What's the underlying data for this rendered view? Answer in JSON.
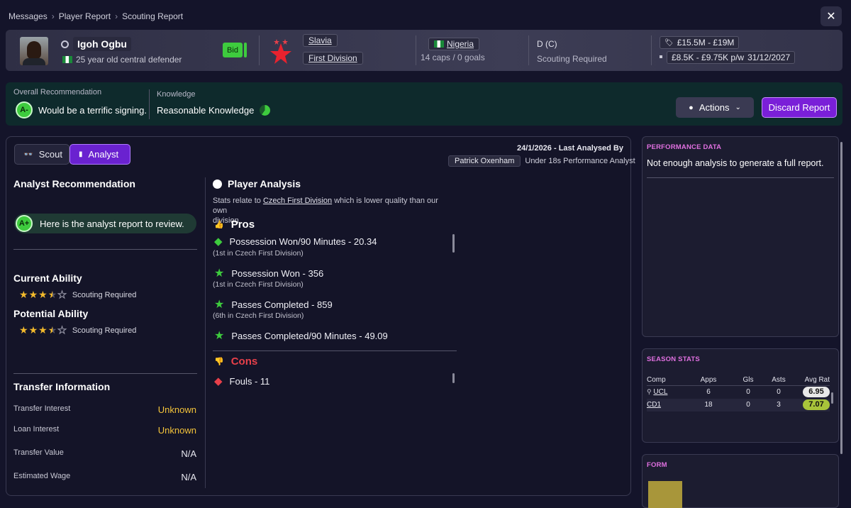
{
  "breadcrumb": [
    "Messages",
    "Player Report",
    "Scouting Report"
  ],
  "player": {
    "name": "Igoh Ogbu",
    "description": "25 year old central defender",
    "bid_label": "Bid"
  },
  "club": {
    "name": "Slavia",
    "league": "First Division"
  },
  "nation": {
    "name": "Nigeria",
    "caps": "14 caps / 0 goals"
  },
  "position": {
    "label": "D (C)",
    "status": "Scouting Required"
  },
  "finance": {
    "value": "£15.5M - £19M",
    "wage": "£8.5K - £9.75K p/w",
    "contract": "31/12/2027"
  },
  "recommendation": {
    "overall_label": "Overall Recommendation",
    "grade": "A-",
    "text": "Would be a terrific signing.",
    "knowledge_label": "Knowledge",
    "knowledge_text": "Reasonable Knowledge"
  },
  "buttons": {
    "actions": "Actions",
    "discard": "Discard Report"
  },
  "tabs": {
    "scout": "Scout",
    "analyst": "Analyst"
  },
  "analysis_meta": {
    "date_line": "24/1/2026 - Last Analysed By",
    "analyst_name": "Patrick Oxenham",
    "analyst_role": "Under 18s Performance Analyst"
  },
  "analyst_rec": {
    "title": "Analyst Recommendation",
    "grade": "A+",
    "text": "Here is the analyst report to review."
  },
  "abilities": {
    "current_title": "Current Ability",
    "current_status": "Scouting Required",
    "current_stars": 3.5,
    "potential_title": "Potential Ability",
    "potential_status": "Scouting Required",
    "potential_stars": 3.5
  },
  "transfer": {
    "title": "Transfer Information",
    "rows": [
      {
        "label": "Transfer Interest",
        "value": "Unknown"
      },
      {
        "label": "Loan Interest",
        "value": "Unknown"
      },
      {
        "label": "Transfer Value",
        "value": "N/A"
      },
      {
        "label": "Estimated Wage",
        "value": "N/A"
      }
    ]
  },
  "player_analysis": {
    "title": "Player Analysis",
    "note_prefix": "Stats relate to",
    "note_link": "Czech First Division",
    "note_suffix": "which is lower quality than our own",
    "note_line2": "division.",
    "pros_title": "Pros",
    "pros": [
      {
        "text": "Possession Won/90 Minutes - 20.34",
        "sub": "(1st in Czech First Division)"
      },
      {
        "text": "Possession Won - 356",
        "sub": "(1st in Czech First Division)"
      },
      {
        "text": "Passes Completed - 859",
        "sub": "(6th in Czech First Division)"
      },
      {
        "text": "Passes Completed/90 Minutes - 49.09",
        "sub": ""
      }
    ],
    "cons_title": "Cons",
    "cons": [
      {
        "text": "Fouls - 11"
      }
    ]
  },
  "performance": {
    "title": "PERFORMANCE DATA",
    "text": "Not enough analysis to generate a full report."
  },
  "season_stats": {
    "title": "SEASON STATS",
    "headers": [
      "Comp",
      "Apps",
      "Gls",
      "Asts",
      "Avg Rat"
    ],
    "rows": [
      {
        "comp": "UCL",
        "apps": "6",
        "gls": "0",
        "asts": "0",
        "rat": "6.95",
        "rat_color": "#e8e8e8"
      },
      {
        "comp": "CD1",
        "apps": "18",
        "gls": "0",
        "asts": "3",
        "rat": "7.07",
        "rat_color": "#a8c43a"
      }
    ]
  },
  "form": {
    "title": "FORM",
    "bar_color": "#a8963a"
  },
  "colors": {
    "accent_purple": "#7a1fd8",
    "grade_green": "#3ecb3e",
    "pros_green": "#3ecb3e",
    "cons_red": "#e8404a",
    "highlight_yellow": "#f2c23a"
  }
}
